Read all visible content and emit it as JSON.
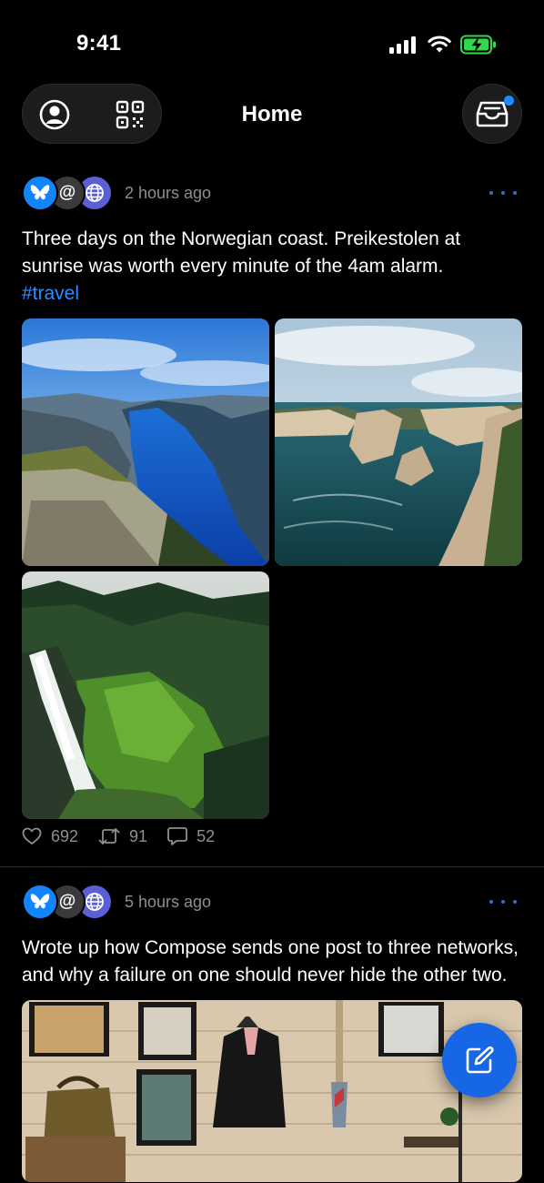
{
  "status_bar": {
    "time": "9:41",
    "icons": [
      "signal-icon",
      "wifi-icon",
      "battery-charging-icon"
    ]
  },
  "header": {
    "title": "Home",
    "left_icons": [
      "profile-icon",
      "qr-code-icon"
    ],
    "right_icon": "inbox-icon",
    "has_unread": true
  },
  "posts": [
    {
      "networks": [
        "bluesky-icon",
        "mastodon-icon",
        "web-icon"
      ],
      "time": "2 hours ago",
      "text": "Three days on the Norwegian coast. Preikestolen at sunrise was worth every minute of the 4am alarm.",
      "hashtag": "#travel",
      "media": [
        "fjord-photo",
        "sea-cliffs-photo",
        "waterfall-photo"
      ],
      "stats": {
        "likes": "692",
        "reposts": "91",
        "replies": "52"
      }
    },
    {
      "networks": [
        "bluesky-icon",
        "mastodon-icon",
        "web-icon"
      ],
      "time": "5 hours ago",
      "text": "Wrote up how Compose sends one post to three networks, and why a failure on one should never hide the other two.",
      "media": [
        "shop-interior-photo"
      ]
    }
  ],
  "fab": {
    "icon": "compose-icon"
  },
  "colors": {
    "background": "#000000",
    "accent": "#1766e6",
    "hashtag": "#2f8bff",
    "muted_text": "#8e8e93",
    "bluesky": "#1185fe",
    "web_badge": "#5b5fd6"
  }
}
